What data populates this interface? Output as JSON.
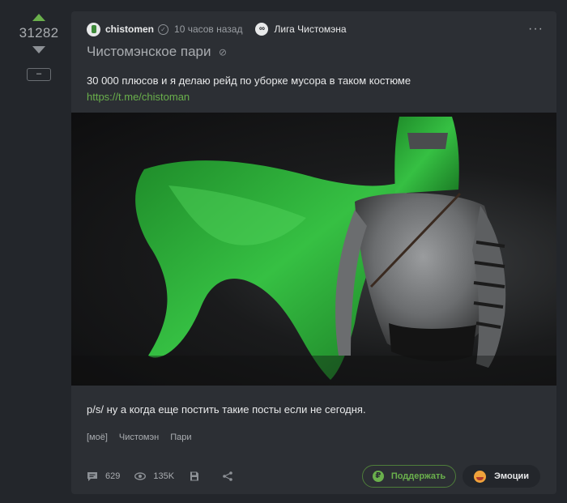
{
  "rating": {
    "score": "31282",
    "minus_label": "–"
  },
  "post": {
    "author": "chistomen",
    "time": "10 часов назад",
    "community": "Лига Чистомэна",
    "title": "Чистомэнское пари",
    "text1": "30 000 плюсов и я делаю рейд по уборке мусора в таком костюме",
    "link": "https://t.me/chistoman",
    "text2": "p/s/ ну а когда еще постить такие посты если не сегодня.",
    "tags": [
      "[моё]",
      "Чистомэн",
      "Пари"
    ]
  },
  "footer": {
    "comments": "629",
    "views": "135K",
    "donate_label": "Поддержать",
    "emotions_label": "Эмоции"
  },
  "colors": {
    "accent": "#6ab04c",
    "cape": "#2fb33a",
    "background": "#23262b",
    "card": "#2c2f34"
  },
  "icons": [
    "arrow-up-icon",
    "arrow-down-icon",
    "verified-icon",
    "more-icon",
    "link-icon",
    "comment-icon",
    "eye-icon",
    "save-icon",
    "share-icon",
    "ruble-icon",
    "emoji-icon"
  ]
}
